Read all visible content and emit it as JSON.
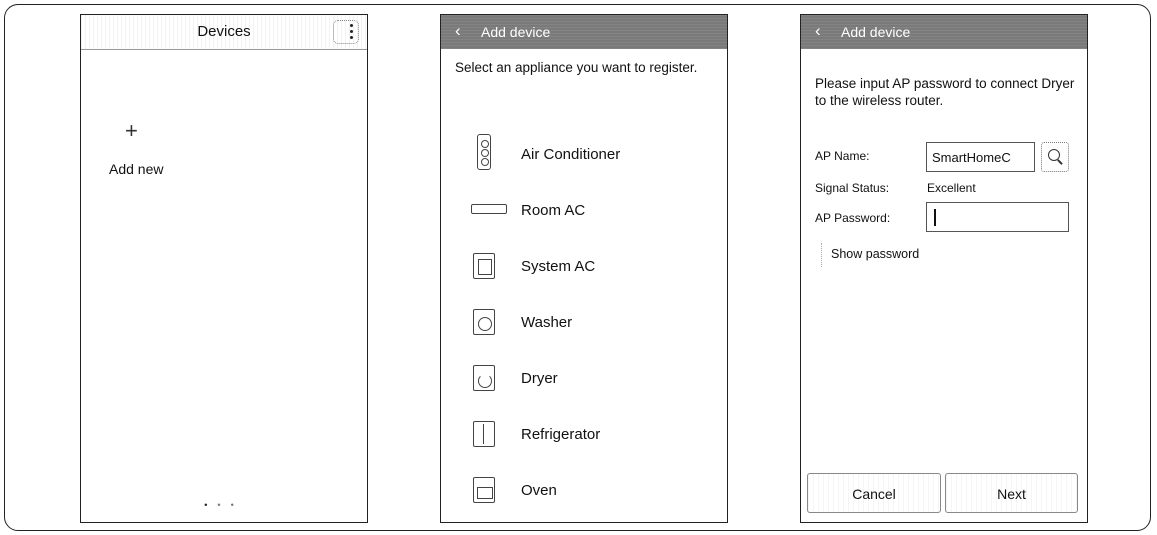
{
  "screen1": {
    "title": "Devices",
    "add_icon": "+",
    "add_label": "Add new",
    "pager": [
      "•",
      "•",
      "•"
    ]
  },
  "screen2": {
    "back_icon": "‹",
    "title": "Add device",
    "instruction": "Select an appliance you want to register.",
    "items": [
      {
        "label": "Air Conditioner",
        "icon": "air-conditioner-icon"
      },
      {
        "label": "Room AC",
        "icon": "room-ac-icon"
      },
      {
        "label": "System AC",
        "icon": "system-ac-icon"
      },
      {
        "label": "Washer",
        "icon": "washer-icon"
      },
      {
        "label": "Dryer",
        "icon": "dryer-icon"
      },
      {
        "label": "Refrigerator",
        "icon": "refrigerator-icon"
      },
      {
        "label": "Oven",
        "icon": "oven-icon"
      }
    ]
  },
  "screen3": {
    "back_icon": "‹",
    "title": "Add device",
    "instruction": "Please input AP password to connect Dryer to the wireless router.",
    "ap_name_label": "AP Name:",
    "ap_name_value": "SmartHomeC",
    "signal_label": "Signal Status:",
    "signal_value": "Excellent",
    "password_label": "AP Password:",
    "password_value": "",
    "show_password_label": "Show password",
    "cancel_label": "Cancel",
    "next_label": "Next"
  }
}
